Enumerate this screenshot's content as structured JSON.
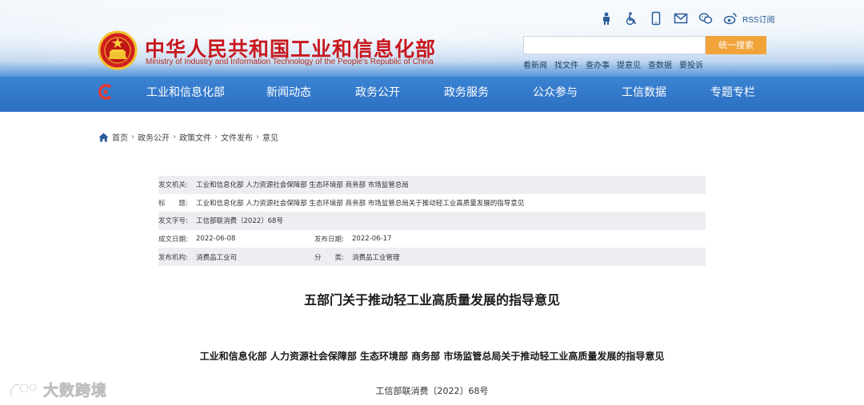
{
  "header": {
    "title": "中华人民共和国工业和信息化部",
    "subtitle": "Ministry of Industry and Information Technology of the People's Republic of China",
    "rss_label": "RSS订阅",
    "search": {
      "placeholder": "",
      "button": "统一搜索"
    },
    "quick_links": [
      "看新闻",
      "找文件",
      "查办事",
      "提意见",
      "查数据",
      "要投诉"
    ]
  },
  "nav": {
    "items": [
      "工业和信息化部",
      "新闻动态",
      "政务公开",
      "政务服务",
      "公众参与",
      "工信数据",
      "专题专栏"
    ]
  },
  "breadcrumb": [
    "首页",
    "政务公开",
    "政策文件",
    "文件发布",
    "意见"
  ],
  "meta": {
    "issuer_label": "发文机关:",
    "issuer": "工业和信息化部 人力资源社会保障部 生态环境部 商务部 市场监管总局",
    "title_label": "标　　题:",
    "title": "工业和信息化部 人力资源社会保障部 生态环境部 商务部 市场监管总局关于推动轻工业高质量发展的指导意见",
    "docno_label": "发文字号:",
    "docno": "工信部联消费〔2022〕68号",
    "created_label": "成文日期:",
    "created": "2022-06-08",
    "published_label": "发布日期:",
    "published": "2022-06-17",
    "office_label": "发布机构:",
    "office": "消费品工业司",
    "category_label": "分　　类:",
    "category": "消费品工业管理"
  },
  "document": {
    "title": "五部门关于推动轻工业高质量发展的指导意见",
    "subtitle": "工业和信息化部 人力资源社会保障部 生态环境部 商务部 市场监管总局关于推动轻工业高质量发展的指导意见",
    "number": "工信部联消费〔2022〕68号"
  },
  "watermark": {
    "text": "大数跨境"
  },
  "colors": {
    "title_red": "#c8171e",
    "nav_blue": "#2c6fc2",
    "search_orange": "#f1a33a"
  },
  "icons": [
    "accessibility-person-icon",
    "wheelchair-icon",
    "mobile-phone-icon",
    "mail-icon",
    "wechat-icon",
    "weibo-icon"
  ]
}
